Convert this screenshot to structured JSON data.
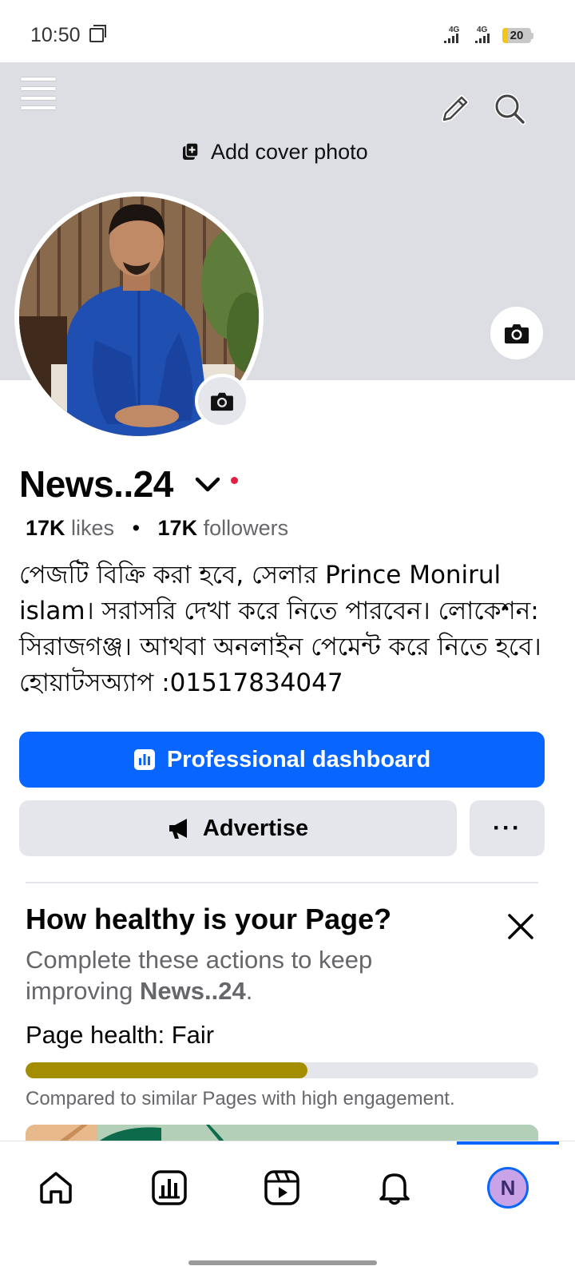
{
  "status_bar": {
    "time": "10:50",
    "network_1": "4G",
    "network_2": "4G",
    "battery_level": "20",
    "battery_fraction": 0.2,
    "battery_color": "#f5c518"
  },
  "cover": {
    "background_color": "#dcdee3",
    "add_cover_label": "Add cover photo",
    "icons": [
      "menu-icon",
      "pencil-icon",
      "search-icon",
      "camera-icon"
    ]
  },
  "profile": {
    "page_name": "News..24",
    "likes_count": "17K",
    "likes_label": " likes",
    "separator": "•",
    "followers_count": "17K",
    "followers_label": " followers",
    "bio": "পেজটি বিক্রি করা হবে, সেলার Prince Monirul islam। সরাসরি দেখা করে নিতে পারবেন। লোকেশন: সিরাজগঞ্জ। আথবা অনলাইন পেমেন্ট করে নিতে হবে। হোয়াটসঅ্যাপ :01517834047"
  },
  "actions": {
    "professional_dashboard_label": "Professional dashboard",
    "advertise_label": "Advertise",
    "more_label": "···",
    "primary_color": "#0866ff"
  },
  "health_card": {
    "title": "How healthy is your Page?",
    "description_prefix": "Complete these actions to keep improving ",
    "description_page": "News..24",
    "description_suffix": ".",
    "status_label": "Page health: ",
    "status_value": "Fair",
    "progress": 0.55,
    "progress_color": "#a38d00",
    "note": "Compared to similar Pages with high engagement."
  },
  "bottom_nav": {
    "items": [
      "home-icon",
      "dashboard-icon",
      "reels-icon",
      "notifications-icon",
      "profile-avatar"
    ],
    "avatar_initial": "N",
    "active_item": "profile-avatar"
  }
}
